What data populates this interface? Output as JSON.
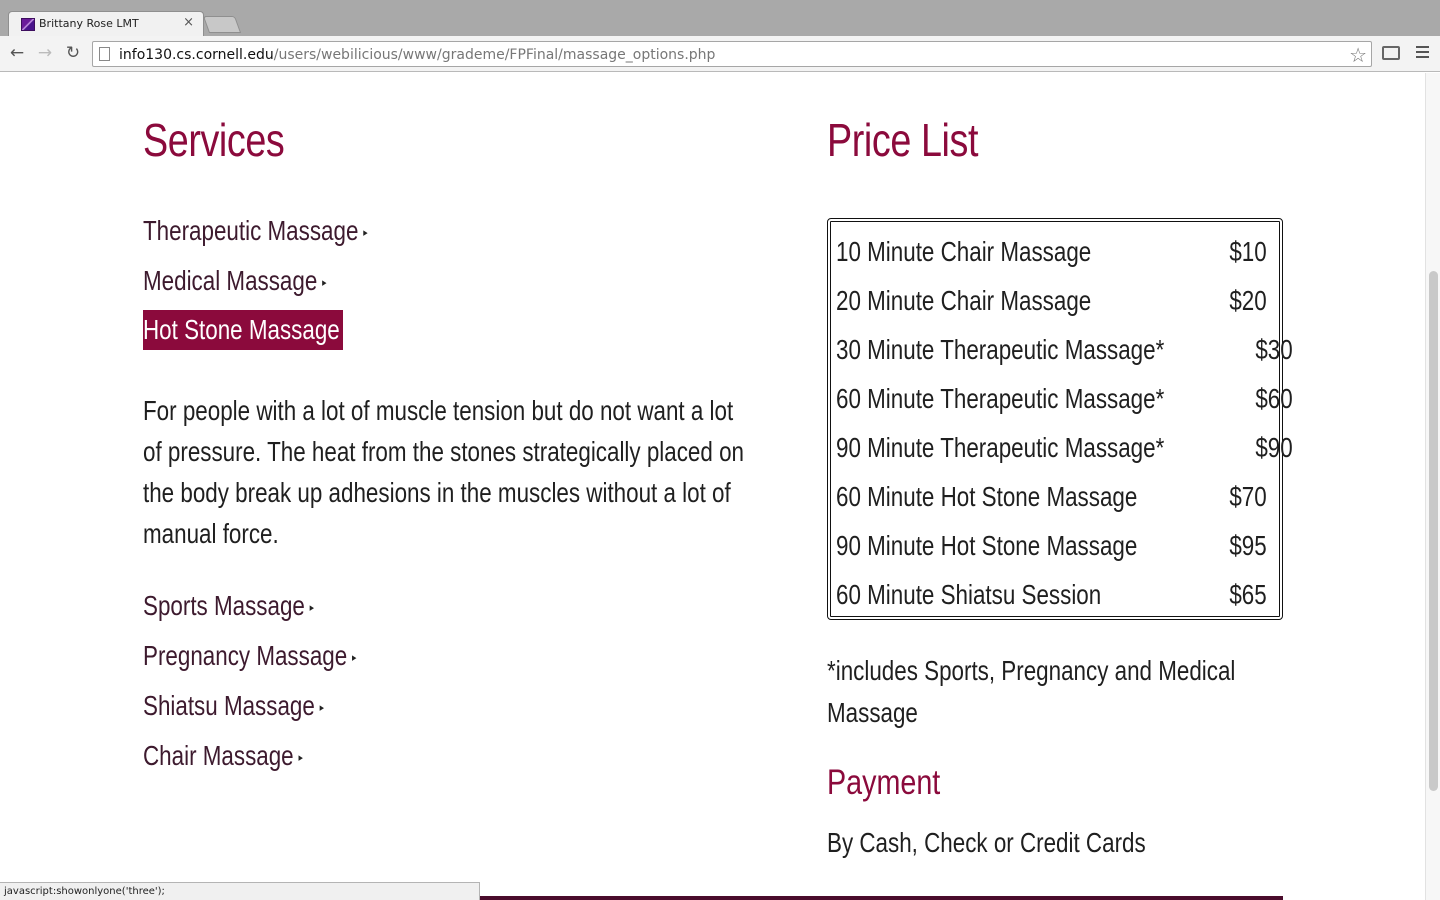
{
  "browser": {
    "tab_title": "Brittany Rose LMT",
    "tab_close": "×",
    "url_host": "info130.cs.cornell.edu",
    "url_path": "/users/webilicious/www/grademe/FPFinal/massage_options.php",
    "back": "←",
    "forward": "→",
    "reload": "↻",
    "star": "☆"
  },
  "services": {
    "heading": "Services",
    "items_before": [
      {
        "label": "Therapeutic Massage"
      },
      {
        "label": "Medical Massage"
      }
    ],
    "active": {
      "label": "Hot Stone Massage"
    },
    "description": "For people with a lot of muscle tension but do not want a lot of pressure. The heat from the stones strategically placed on the body break up adhesions in the muscles without a lot of manual force.",
    "items_after": [
      {
        "label": "Sports Massage"
      },
      {
        "label": "Pregnancy Massage"
      },
      {
        "label": "Shiatsu Massage"
      },
      {
        "label": "Chair Massage"
      }
    ],
    "arrow": "▸"
  },
  "price_list": {
    "heading": "Price List",
    "rows": [
      {
        "item": "10 Minute Chair Massage",
        "price": "$10"
      },
      {
        "item": "20 Minute Chair Massage",
        "price": "$20"
      },
      {
        "item": "30 Minute Therapeutic Massage*",
        "price": "$30"
      },
      {
        "item": "60 Minute Therapeutic Massage*",
        "price": "$60"
      },
      {
        "item": "90 Minute Therapeutic Massage*",
        "price": "$90"
      },
      {
        "item": "60 Minute Hot Stone Massage",
        "price": "$70"
      },
      {
        "item": "90 Minute Hot Stone Massage",
        "price": "$95"
      },
      {
        "item": "60 Minute Shiatsu Session",
        "price": "$65"
      }
    ],
    "note": "*includes Sports, Pregnancy and Medical Massage"
  },
  "payment": {
    "heading": "Payment",
    "text": "By Cash, Check or Credit Cards"
  },
  "status_bar": "javascript:showonlyone('three');",
  "colors": {
    "accent": "#8b0a3c",
    "footer": "#4a0c2c"
  }
}
